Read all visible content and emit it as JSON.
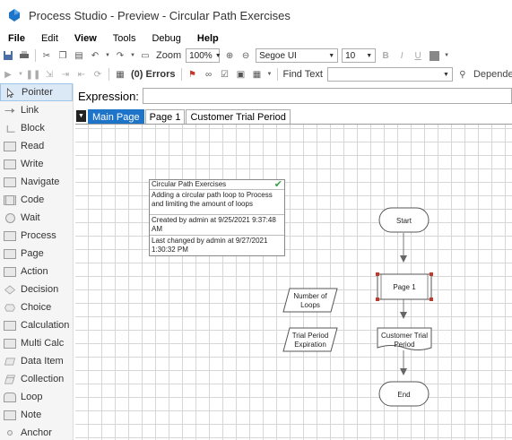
{
  "window": {
    "title": "Process Studio  - Preview - Circular Path Exercises"
  },
  "menu": [
    "File",
    "Edit",
    "View",
    "Tools",
    "Debug",
    "Help"
  ],
  "toolbar": {
    "zoom_label": "Zoom",
    "zoom_value": "100%",
    "font_family": "Segoe UI",
    "font_size": "10",
    "bold_label": "B",
    "italic_label": "I",
    "underline_label": "U",
    "errors_label": "(0) Errors",
    "find_label": "Find Text",
    "dependencies_label": "Dependencie"
  },
  "palette": [
    {
      "label": "Pointer",
      "icon": "pointer-icon",
      "selected": true
    },
    {
      "label": "Link",
      "icon": "link-icon"
    },
    {
      "label": "Block",
      "icon": "block-icon"
    },
    {
      "label": "Read",
      "icon": "read-icon"
    },
    {
      "label": "Write",
      "icon": "write-icon"
    },
    {
      "label": "Navigate",
      "icon": "navigate-icon"
    },
    {
      "label": "Code",
      "icon": "code-icon"
    },
    {
      "label": "Wait",
      "icon": "wait-icon"
    },
    {
      "label": "Process",
      "icon": "process-icon"
    },
    {
      "label": "Page",
      "icon": "page-icon"
    },
    {
      "label": "Action",
      "icon": "action-icon"
    },
    {
      "label": "Decision",
      "icon": "decision-icon"
    },
    {
      "label": "Choice",
      "icon": "choice-icon"
    },
    {
      "label": "Calculation",
      "icon": "calculation-icon"
    },
    {
      "label": "Multi Calc",
      "icon": "multi-calc-icon"
    },
    {
      "label": "Data Item",
      "icon": "data-item-icon"
    },
    {
      "label": "Collection",
      "icon": "collection-icon"
    },
    {
      "label": "Loop",
      "icon": "loop-icon"
    },
    {
      "label": "Note",
      "icon": "note-icon"
    },
    {
      "label": "Anchor",
      "icon": "anchor-icon"
    }
  ],
  "expression": {
    "label": "Expression:",
    "value": ""
  },
  "tabs": [
    {
      "label": "Main Page",
      "active": true
    },
    {
      "label": "Page 1"
    },
    {
      "label": "Customer Trial Period"
    }
  ],
  "info_box": {
    "title": "Circular Path Exercises",
    "description": "Adding a circular path loop to Process and limiting the amount of loops",
    "created": "Created by admin at 9/25/2021 9:37:48 AM",
    "changed": "Last changed by admin at 9/27/2021 1:30:32 PM"
  },
  "flow": {
    "start": "Start",
    "page1": "Page 1",
    "customer_trial_line1": "Customer Trial",
    "customer_trial_line2": "Period",
    "end": "End",
    "number_of_loops_line1": "Number of",
    "number_of_loops_line2": "Loops",
    "trial_period_line1": "Trial Period",
    "trial_period_line2": "Expiration"
  },
  "colors": {
    "accent": "#1e74c8",
    "selection_handle": "#c0392b",
    "check": "#3aa04a"
  }
}
